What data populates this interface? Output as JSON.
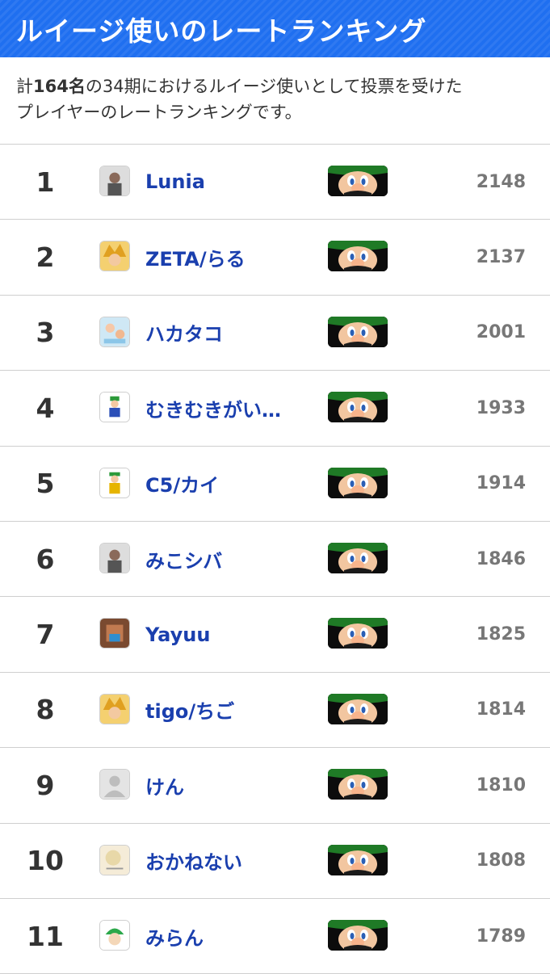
{
  "header": {
    "title": "ルイージ使いのレートランキング"
  },
  "description": {
    "prefix": "計",
    "count": "164名",
    "suffix_line1": "の34期におけるルイージ使いとして投票を受けた",
    "line2": "プレイヤーのレートランキングです。"
  },
  "rows": [
    {
      "rank": "1",
      "name": "Lunia",
      "rate": "2148",
      "avatar": "photo-avatar-icon"
    },
    {
      "rank": "2",
      "name": "ZETA/らる",
      "rate": "2137",
      "avatar": "anime-avatar-icon"
    },
    {
      "rank": "3",
      "name": "ハカタコ",
      "rate": "2001",
      "avatar": "illustration-avatar-icon"
    },
    {
      "rank": "4",
      "name": "むきむきがいこつ",
      "rate": "1933",
      "avatar": "luigi-avatar-icon"
    },
    {
      "rank": "5",
      "name": "C5/カイ",
      "rate": "1914",
      "avatar": "character-avatar-icon"
    },
    {
      "rank": "6",
      "name": "みこシバ",
      "rate": "1846",
      "avatar": "photo-avatar-icon"
    },
    {
      "rank": "7",
      "name": "Yayuu",
      "rate": "1825",
      "avatar": "pixel-avatar-icon"
    },
    {
      "rank": "8",
      "name": "tigo/ちご",
      "rate": "1814",
      "avatar": "anime-avatar-icon"
    },
    {
      "rank": "9",
      "name": "けん",
      "rate": "1810",
      "avatar": "default-user-icon"
    },
    {
      "rank": "10",
      "name": "おかねない",
      "rate": "1808",
      "avatar": "drawing-avatar-icon"
    },
    {
      "rank": "11",
      "name": "みらん",
      "rate": "1789",
      "avatar": "green-cap-avatar-icon"
    }
  ],
  "fighter_icon": "luigi-face-icon"
}
